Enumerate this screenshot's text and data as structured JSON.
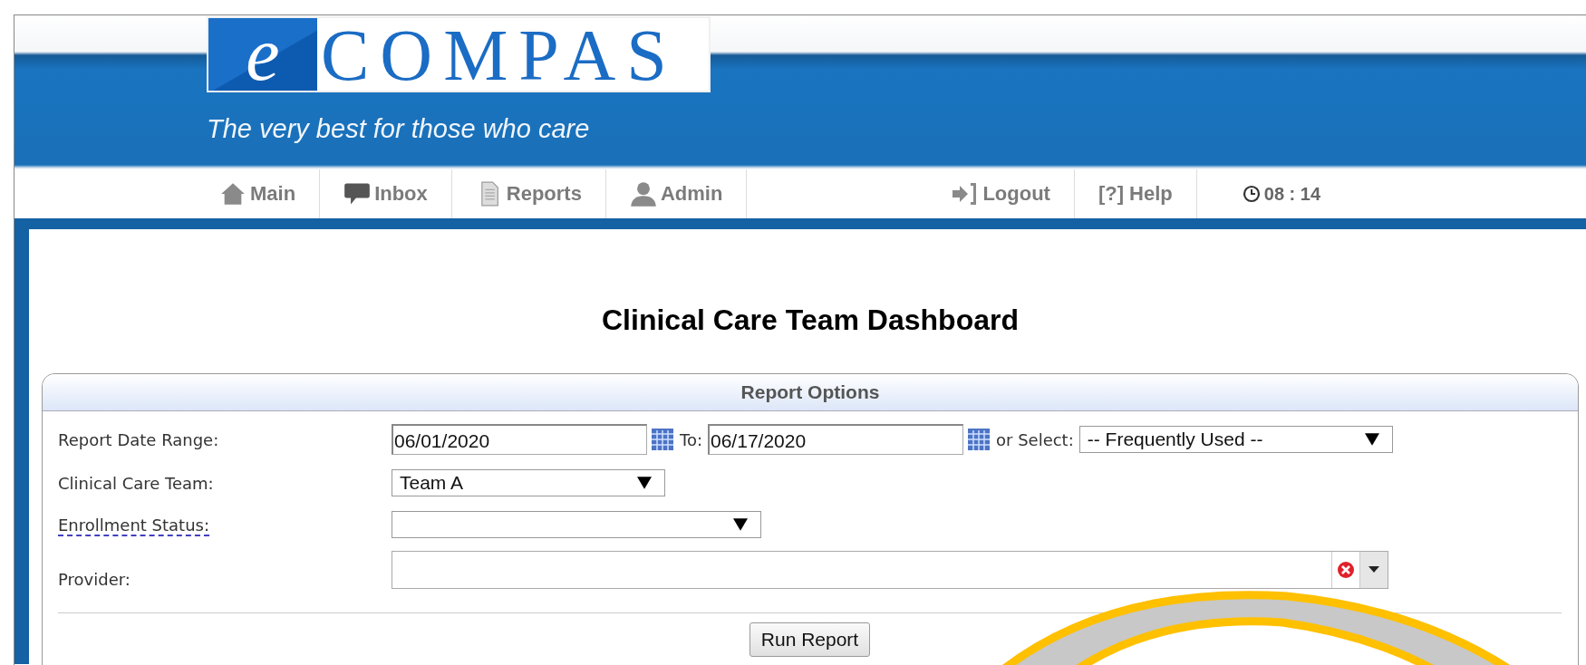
{
  "brand": {
    "logo_letter": "e",
    "logo_text": "COMPAS",
    "tagline": "The very best for those who care"
  },
  "nav": {
    "left": [
      {
        "kind": "house",
        "label": "Main"
      },
      {
        "kind": "speech",
        "label": "Inbox"
      },
      {
        "kind": "document",
        "label": "Reports"
      },
      {
        "kind": "person",
        "label": "Admin"
      }
    ],
    "right": [
      {
        "kind": "logout",
        "label": "Logout"
      },
      {
        "kind": "plain",
        "label": "[?] Help"
      },
      {
        "kind": "clock",
        "label": "08 : 14"
      }
    ]
  },
  "page_title": "Clinical Care Team Dashboard",
  "report_options": {
    "title": "Report Options",
    "date_range": {
      "label": "Report Date Range:",
      "from": "06/01/2020",
      "to_label": "To:",
      "to": "06/17/2020",
      "select_label": "or Select:",
      "select_value": "-- Frequently Used --"
    },
    "care_team": {
      "label": "Clinical Care Team:",
      "value": "Team A"
    },
    "enrollment": {
      "label": "Enrollment Status:"
    },
    "provider": {
      "label": "Provider:"
    },
    "button": "Run Report"
  }
}
